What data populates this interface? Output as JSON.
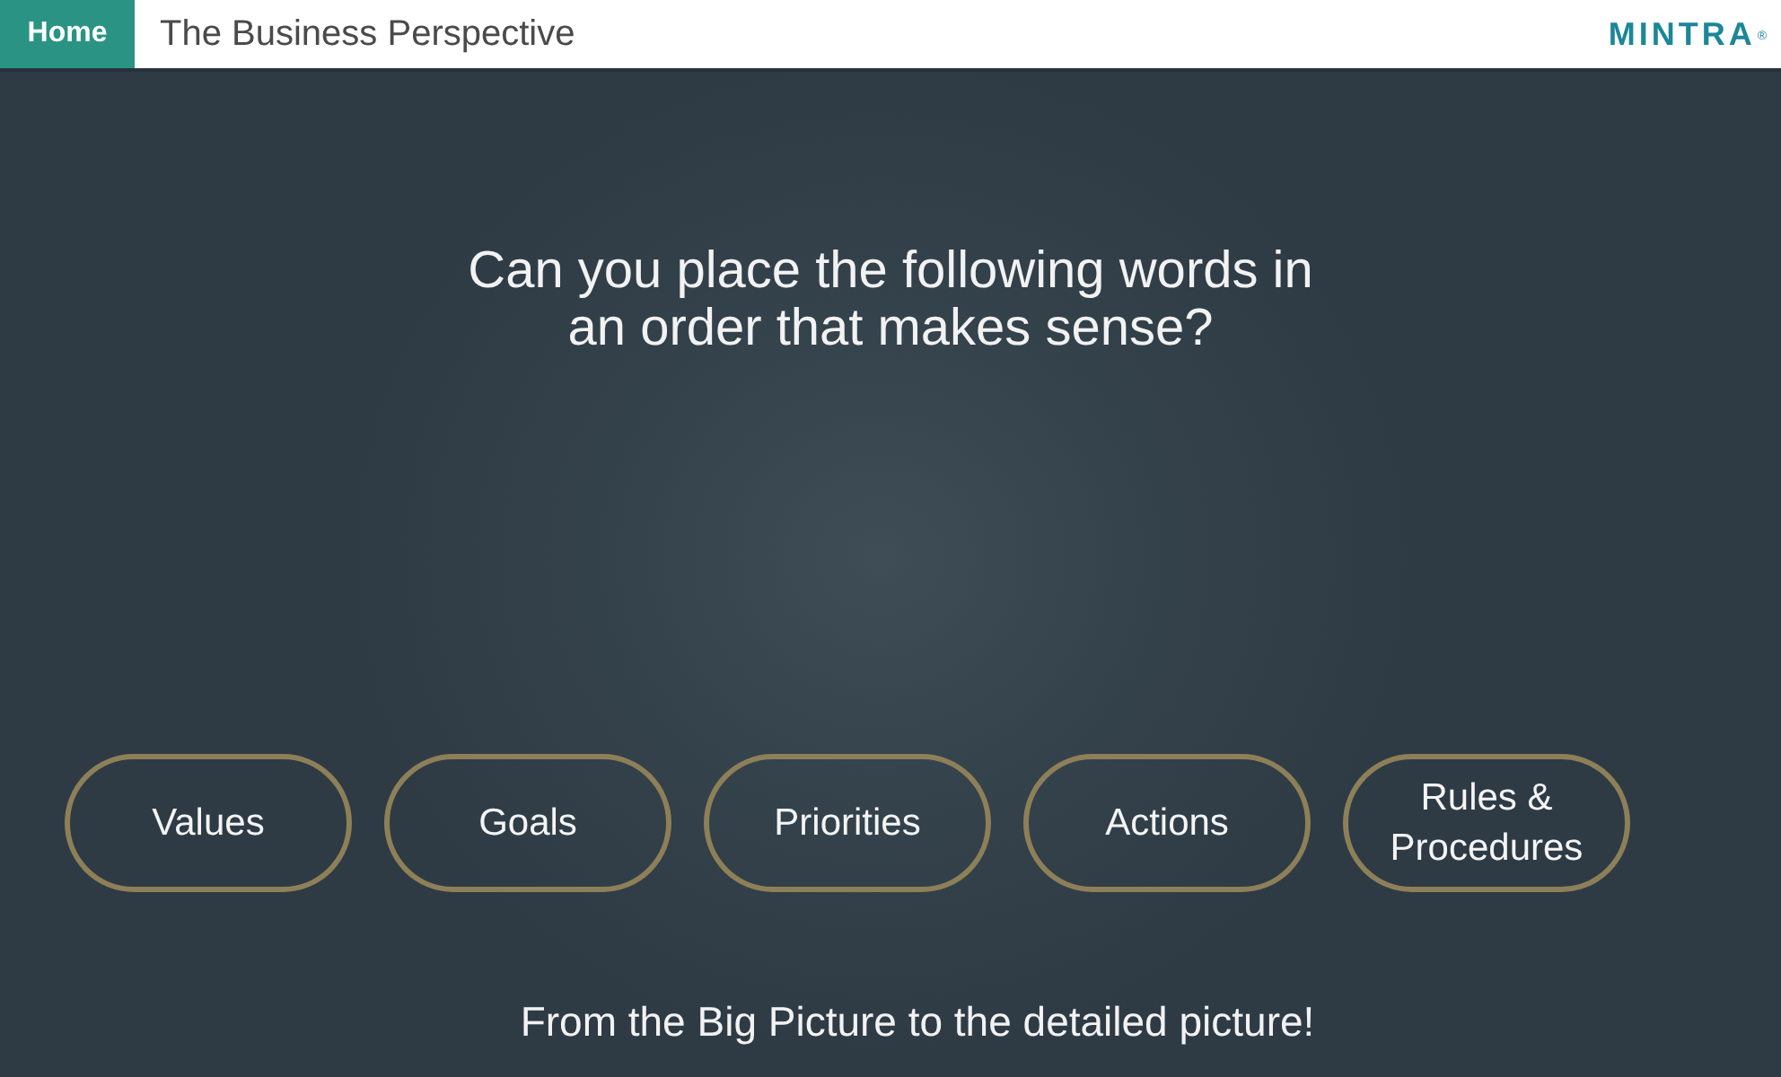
{
  "header": {
    "home_button": "Home",
    "title": "The Business Perspective",
    "logo": {
      "text": "MINTRA",
      "mark": "®"
    }
  },
  "question": "Can you place the following words in an order that makes sense?",
  "words": [
    "Values",
    "Goals",
    "Priorities",
    "Actions",
    "Rules & Procedures"
  ],
  "footer": "From the Big Picture to the detailed picture!"
}
